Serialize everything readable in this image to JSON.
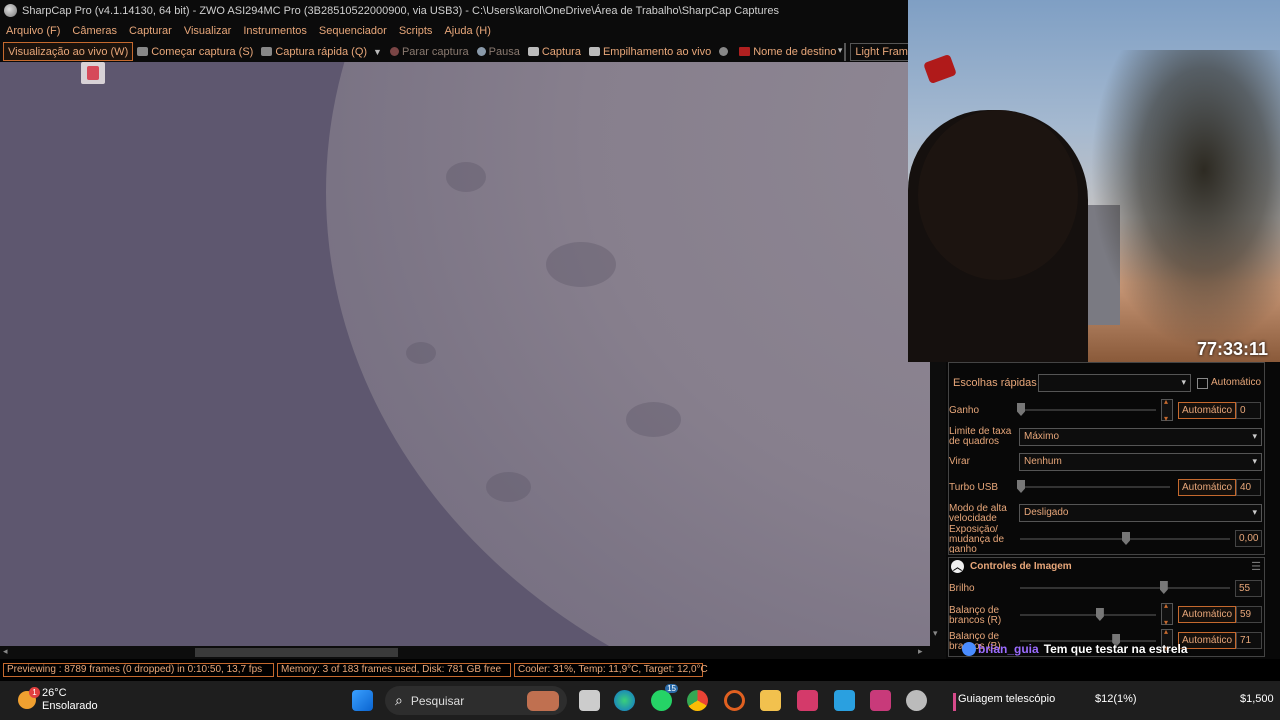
{
  "window": {
    "title": "SharpCap Pro (v4.1.14130, 64 bit) - ZWO ASI294MC Pro (3B28510522000900, via USB3) - C:\\Users\\karol\\OneDrive\\Área de Trabalho\\SharpCap Captures"
  },
  "menu": {
    "items": [
      "Arquivo (F)",
      "Câmeras",
      "Capturar",
      "Visualizar",
      "Instrumentos",
      "Sequenciador",
      "Scripts",
      "Ajuda (H)"
    ]
  },
  "toolbar": {
    "live_view": "Visualização ao vivo (W)",
    "start_capture": "Começar captura (S)",
    "quick_capture": "Captura rápida (Q)",
    "stop_capture": "Parar captura",
    "pause": "Pausa",
    "capture": "Captura",
    "live_stack": "Empilhamento ao vivo",
    "target_name": "Nome de destino",
    "target_value": "",
    "frame_type": "Light Frames"
  },
  "panel": {
    "quick_choices": {
      "label": "Escolhas rápidas",
      "value": "",
      "auto_label": "Automático",
      "auto_checked": false
    },
    "gain": {
      "label": "Ganho",
      "auto": "Automático",
      "value": "0",
      "level": 0.0
    },
    "frame_rate_limit": {
      "label": "Limite de taxa de quadros",
      "value": "Máximo"
    },
    "flip": {
      "label": "Virar",
      "value": "Nenhum"
    },
    "usb_turbo": {
      "label": "Turbo USB",
      "auto": "Automático",
      "value": "40",
      "level": 0.0
    },
    "high_speed_mode": {
      "label": "Modo de alta velocidade",
      "value": "Desligado"
    },
    "exposure_gain_change": {
      "label": "Exposição/ mudança de ganho",
      "value": "0,00",
      "level": 0.5
    },
    "image_controls": {
      "header": "Controles de Imagem",
      "brightness": {
        "label": "Brilho",
        "value": "55",
        "level": 0.68
      },
      "wb_red": {
        "label": "Balanço de brancos (R)",
        "auto": "Automático",
        "value": "59",
        "level": 0.58
      },
      "wb_blue": {
        "label": "Balanço de brancos (B)",
        "auto": "Automático",
        "value": "71",
        "level": 0.7
      }
    }
  },
  "webcam": {
    "timer": "77:33:11"
  },
  "status": {
    "preview": "Previewing : 8789 frames (0 dropped) in 0:10:50, 13,7 fps",
    "memory": "Memory: 3 of 183 frames used, Disk: 781 GB free",
    "cooler": "Cooler: 31%, Temp: 11,9°C, Target: 12,0°C"
  },
  "chat": {
    "user": "brian_guia",
    "message": "Tem que testar na estrela"
  },
  "taskbar": {
    "weather_temp": "26°C",
    "weather_desc": "Ensolarado",
    "weather_badge": "1",
    "search_placeholder": "Pesquisar",
    "whatsapp_badge": "15",
    "media_label": "Guiagem telescópio",
    "stat_1": "$12(1%)",
    "stat_2": "$1,500"
  },
  "colors": {
    "accent": "#e8a77a",
    "border_accent": "#c5692e",
    "viewport": "#5e576f"
  }
}
